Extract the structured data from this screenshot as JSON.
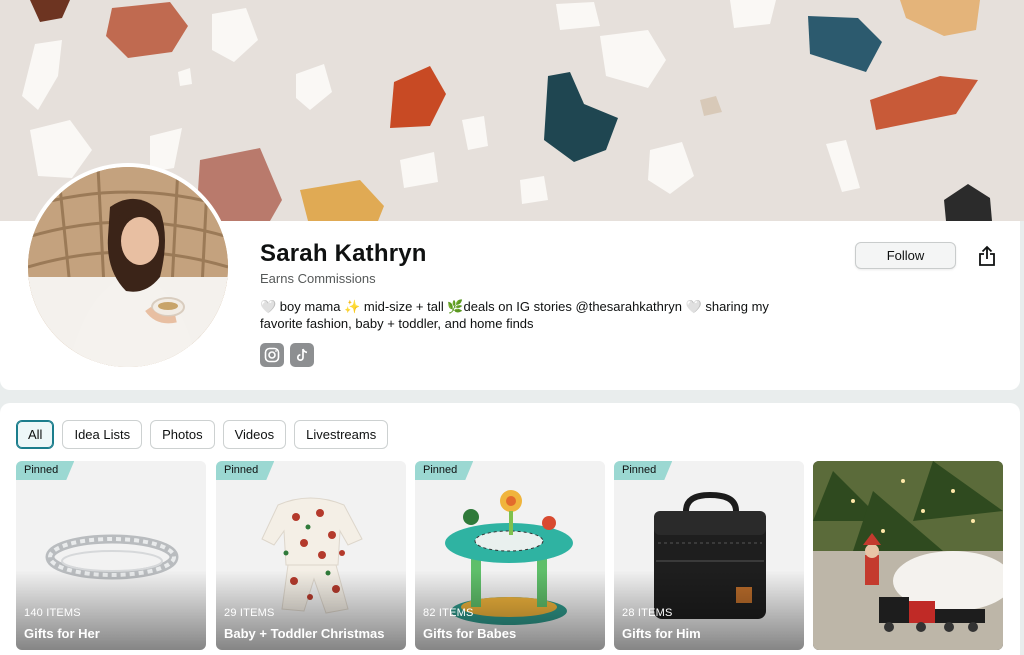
{
  "profile": {
    "name": "Sarah Kathryn",
    "earns": "Earns Commissions",
    "bio": "🤍 boy mama ✨ mid-size + tall 🌿deals on IG stories @thesarahkathryn 🤍 sharing my favorite fashion, baby + toddler, and home finds",
    "social": [
      {
        "icon": "instagram-icon"
      },
      {
        "icon": "tiktok-icon"
      }
    ]
  },
  "actions": {
    "follow_label": "Follow",
    "share_icon": "share-icon"
  },
  "tabs": [
    {
      "label": "All",
      "active": true
    },
    {
      "label": "Idea Lists"
    },
    {
      "label": "Photos"
    },
    {
      "label": "Videos"
    },
    {
      "label": "Livestreams"
    }
  ],
  "lists": [
    {
      "pinned": "Pinned",
      "count": "140 ITEMS",
      "title": "Gifts for Her"
    },
    {
      "pinned": "Pinned",
      "count": "29 ITEMS",
      "title": "Baby + Toddler Christmas"
    },
    {
      "pinned": "Pinned",
      "count": "82 ITEMS",
      "title": "Gifts for Babes"
    },
    {
      "pinned": "Pinned",
      "count": "28 ITEMS",
      "title": "Gifts for Him"
    }
  ],
  "colors": {
    "accent": "#1b7d8c",
    "pinned_badge": "#9bd8d2",
    "banner_bg": "#e7e1dc"
  }
}
